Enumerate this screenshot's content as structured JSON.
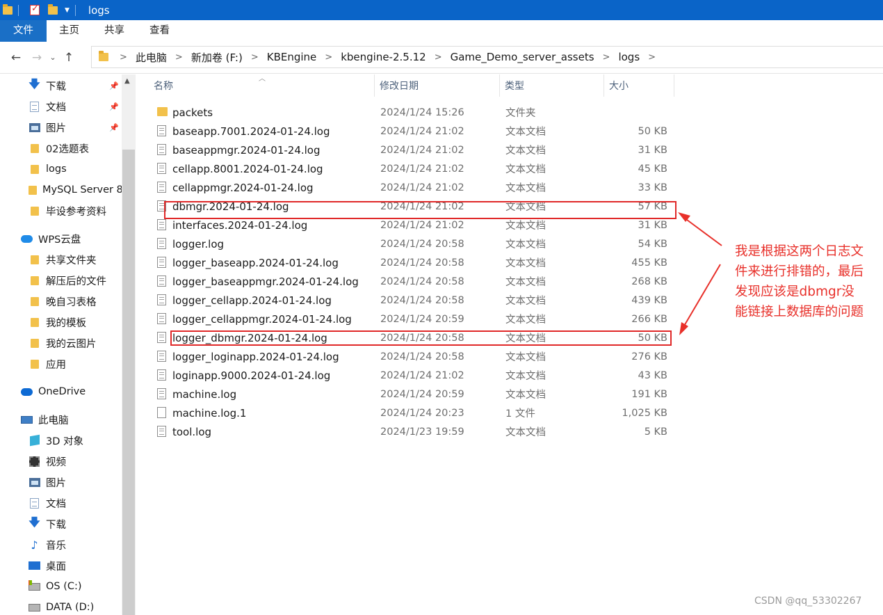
{
  "window": {
    "title": "logs"
  },
  "ribbon": {
    "tabs": [
      "文件",
      "主页",
      "共享",
      "查看"
    ]
  },
  "address": {
    "crumbs": [
      "此电脑",
      "新加卷 (F:)",
      "KBEngine",
      "kbengine-2.5.12",
      "Game_Demo_server_assets",
      "logs"
    ]
  },
  "nav": {
    "items": [
      {
        "label": "下载",
        "icon": "download-icon",
        "pinned": true
      },
      {
        "label": "文档",
        "icon": "document-icon",
        "pinned": true
      },
      {
        "label": "图片",
        "icon": "picture-icon",
        "pinned": true
      },
      {
        "label": "02选题表",
        "icon": "folder-icon"
      },
      {
        "label": "logs",
        "icon": "folder-icon"
      },
      {
        "label": "MySQL Server 8",
        "icon": "folder-icon"
      },
      {
        "label": "毕设参考资料",
        "icon": "folder-icon"
      },
      {
        "label": "WPS云盘",
        "icon": "cloud-icon"
      },
      {
        "label": "共享文件夹",
        "icon": "folder-icon"
      },
      {
        "label": "解压后的文件",
        "icon": "folder-icon"
      },
      {
        "label": "晚自习表格",
        "icon": "folder-icon"
      },
      {
        "label": "我的模板",
        "icon": "folder-icon"
      },
      {
        "label": "我的云图片",
        "icon": "folder-icon"
      },
      {
        "label": "应用",
        "icon": "folder-icon"
      },
      {
        "label": "OneDrive",
        "icon": "onedrive-icon"
      },
      {
        "label": "此电脑",
        "icon": "pc-icon"
      },
      {
        "label": "3D 对象",
        "icon": "cube-icon"
      },
      {
        "label": "视频",
        "icon": "video-icon"
      },
      {
        "label": "图片",
        "icon": "picture-icon"
      },
      {
        "label": "文档",
        "icon": "document-icon"
      },
      {
        "label": "下载",
        "icon": "download-icon"
      },
      {
        "label": "音乐",
        "icon": "music-icon"
      },
      {
        "label": "桌面",
        "icon": "desktop-icon"
      },
      {
        "label": "OS (C:)",
        "icon": "os-drive-icon"
      },
      {
        "label": "DATA (D:)",
        "icon": "drive-icon"
      }
    ]
  },
  "columns": {
    "name": "名称",
    "date": "修改日期",
    "type": "类型",
    "size": "大小"
  },
  "files": [
    {
      "name": "packets",
      "date": "2024/1/24 15:26",
      "type": "文件夹",
      "size": "",
      "icon": "folder-icon"
    },
    {
      "name": "baseapp.7001.2024-01-24.log",
      "date": "2024/1/24 21:02",
      "type": "文本文档",
      "size": "50 KB",
      "icon": "text-file-icon"
    },
    {
      "name": "baseappmgr.2024-01-24.log",
      "date": "2024/1/24 21:02",
      "type": "文本文档",
      "size": "31 KB",
      "icon": "text-file-icon"
    },
    {
      "name": "cellapp.8001.2024-01-24.log",
      "date": "2024/1/24 21:02",
      "type": "文本文档",
      "size": "45 KB",
      "icon": "text-file-icon"
    },
    {
      "name": "cellappmgr.2024-01-24.log",
      "date": "2024/1/24 21:02",
      "type": "文本文档",
      "size": "33 KB",
      "icon": "text-file-icon"
    },
    {
      "name": "dbmgr.2024-01-24.log",
      "date": "2024/1/24 21:02",
      "type": "文本文档",
      "size": "57 KB",
      "icon": "text-file-icon"
    },
    {
      "name": "interfaces.2024-01-24.log",
      "date": "2024/1/24 21:02",
      "type": "文本文档",
      "size": "31 KB",
      "icon": "text-file-icon"
    },
    {
      "name": "logger.log",
      "date": "2024/1/24 20:58",
      "type": "文本文档",
      "size": "54 KB",
      "icon": "text-file-icon"
    },
    {
      "name": "logger_baseapp.2024-01-24.log",
      "date": "2024/1/24 20:58",
      "type": "文本文档",
      "size": "455 KB",
      "icon": "text-file-icon"
    },
    {
      "name": "logger_baseappmgr.2024-01-24.log",
      "date": "2024/1/24 20:58",
      "type": "文本文档",
      "size": "268 KB",
      "icon": "text-file-icon"
    },
    {
      "name": "logger_cellapp.2024-01-24.log",
      "date": "2024/1/24 20:58",
      "type": "文本文档",
      "size": "439 KB",
      "icon": "text-file-icon"
    },
    {
      "name": "logger_cellappmgr.2024-01-24.log",
      "date": "2024/1/24 20:59",
      "type": "文本文档",
      "size": "266 KB",
      "icon": "text-file-icon"
    },
    {
      "name": "logger_dbmgr.2024-01-24.log",
      "date": "2024/1/24 20:58",
      "type": "文本文档",
      "size": "50 KB",
      "icon": "text-file-icon"
    },
    {
      "name": "logger_loginapp.2024-01-24.log",
      "date": "2024/1/24 20:58",
      "type": "文本文档",
      "size": "276 KB",
      "icon": "text-file-icon"
    },
    {
      "name": "loginapp.9000.2024-01-24.log",
      "date": "2024/1/24 21:02",
      "type": "文本文档",
      "size": "43 KB",
      "icon": "text-file-icon"
    },
    {
      "name": "machine.log",
      "date": "2024/1/24 20:59",
      "type": "文本文档",
      "size": "191 KB",
      "icon": "text-file-icon"
    },
    {
      "name": "machine.log.1",
      "date": "2024/1/24 20:23",
      "type": "1 文件",
      "size": "1,025 KB",
      "icon": "file-icon"
    },
    {
      "name": "tool.log",
      "date": "2024/1/23 19:59",
      "type": "文本文档",
      "size": "5 KB",
      "icon": "text-file-icon"
    }
  ],
  "annotation": {
    "lines": [
      "我是根据这两个日志文",
      "件来进行排错的，最后",
      "发现应该是dbmgr没",
      "能链接上数据库的问题"
    ],
    "color": "#e8302a"
  },
  "watermark": "CSDN @qq_53302267",
  "colors": {
    "titlebar": "#0a64c8",
    "file_tab": "#1a6fc6",
    "highlight": "#e02828"
  }
}
